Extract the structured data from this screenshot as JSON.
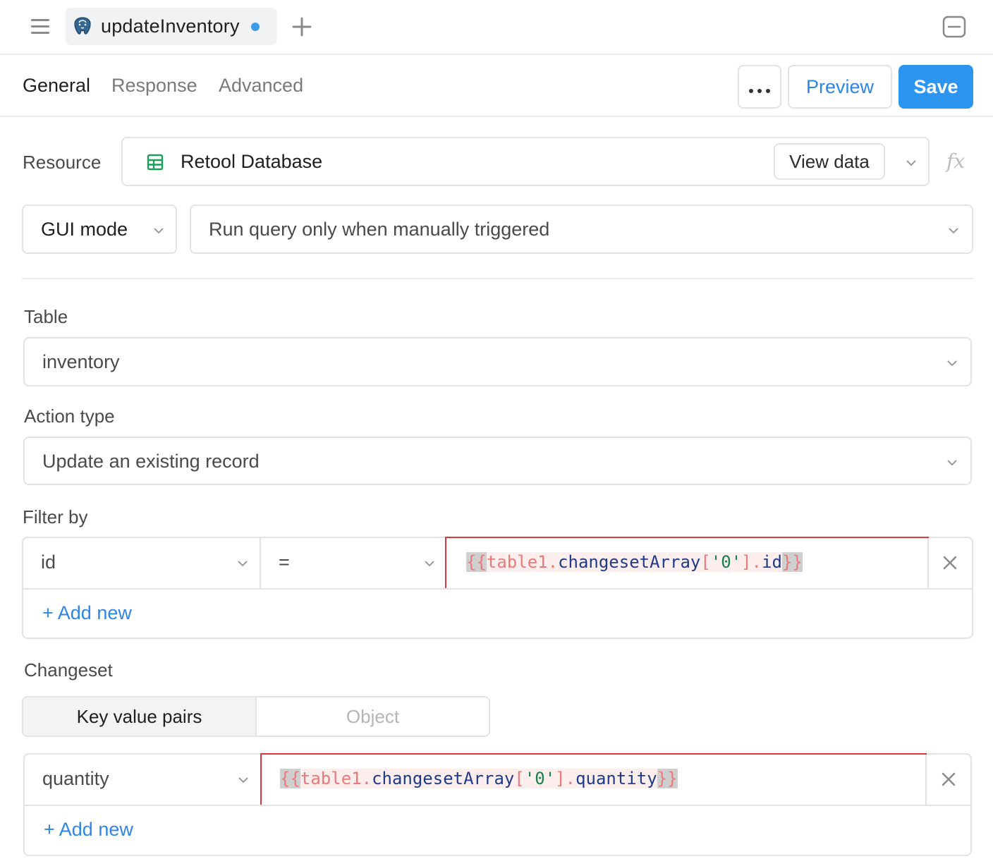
{
  "tabbar": {
    "query_name": "updateInventory",
    "unsaved_dot_color": "#3d9be9"
  },
  "subheader": {
    "tabs": [
      {
        "label": "General"
      },
      {
        "label": "Response"
      },
      {
        "label": "Advanced"
      }
    ],
    "preview_label": "Preview",
    "save_label": "Save"
  },
  "resource": {
    "label": "Resource",
    "value": "Retool Database",
    "view_data_label": "View data",
    "fx_label": "fx"
  },
  "mode": {
    "value": "GUI mode",
    "trigger_value": "Run query only when manually triggered"
  },
  "table": {
    "label": "Table",
    "value": "inventory"
  },
  "action": {
    "label": "Action type",
    "value": "Update an existing record"
  },
  "filter": {
    "label": "Filter by",
    "column": "id",
    "operator": "=",
    "value_open": "{{",
    "value_obj": "table1.",
    "value_prop": "changesetArray",
    "value_bracket_open": "[",
    "value_str": "'0'",
    "value_bracket_close": "].",
    "value_field": "id",
    "value_close": "}}",
    "add_new": "+ Add new"
  },
  "changeset": {
    "label": "Changeset",
    "modes": [
      "Key value pairs",
      "Object"
    ],
    "key": "quantity",
    "value_open": "{{",
    "value_obj": "table1.",
    "value_prop": "changesetArray",
    "value_bracket_open": "[",
    "value_str": "'0'",
    "value_bracket_close": "].",
    "value_field": "quantity",
    "value_close": "}}",
    "add_new": "+ Add new"
  },
  "colors": {
    "accent": "#2b95f0",
    "error_border": "#d9363e"
  }
}
